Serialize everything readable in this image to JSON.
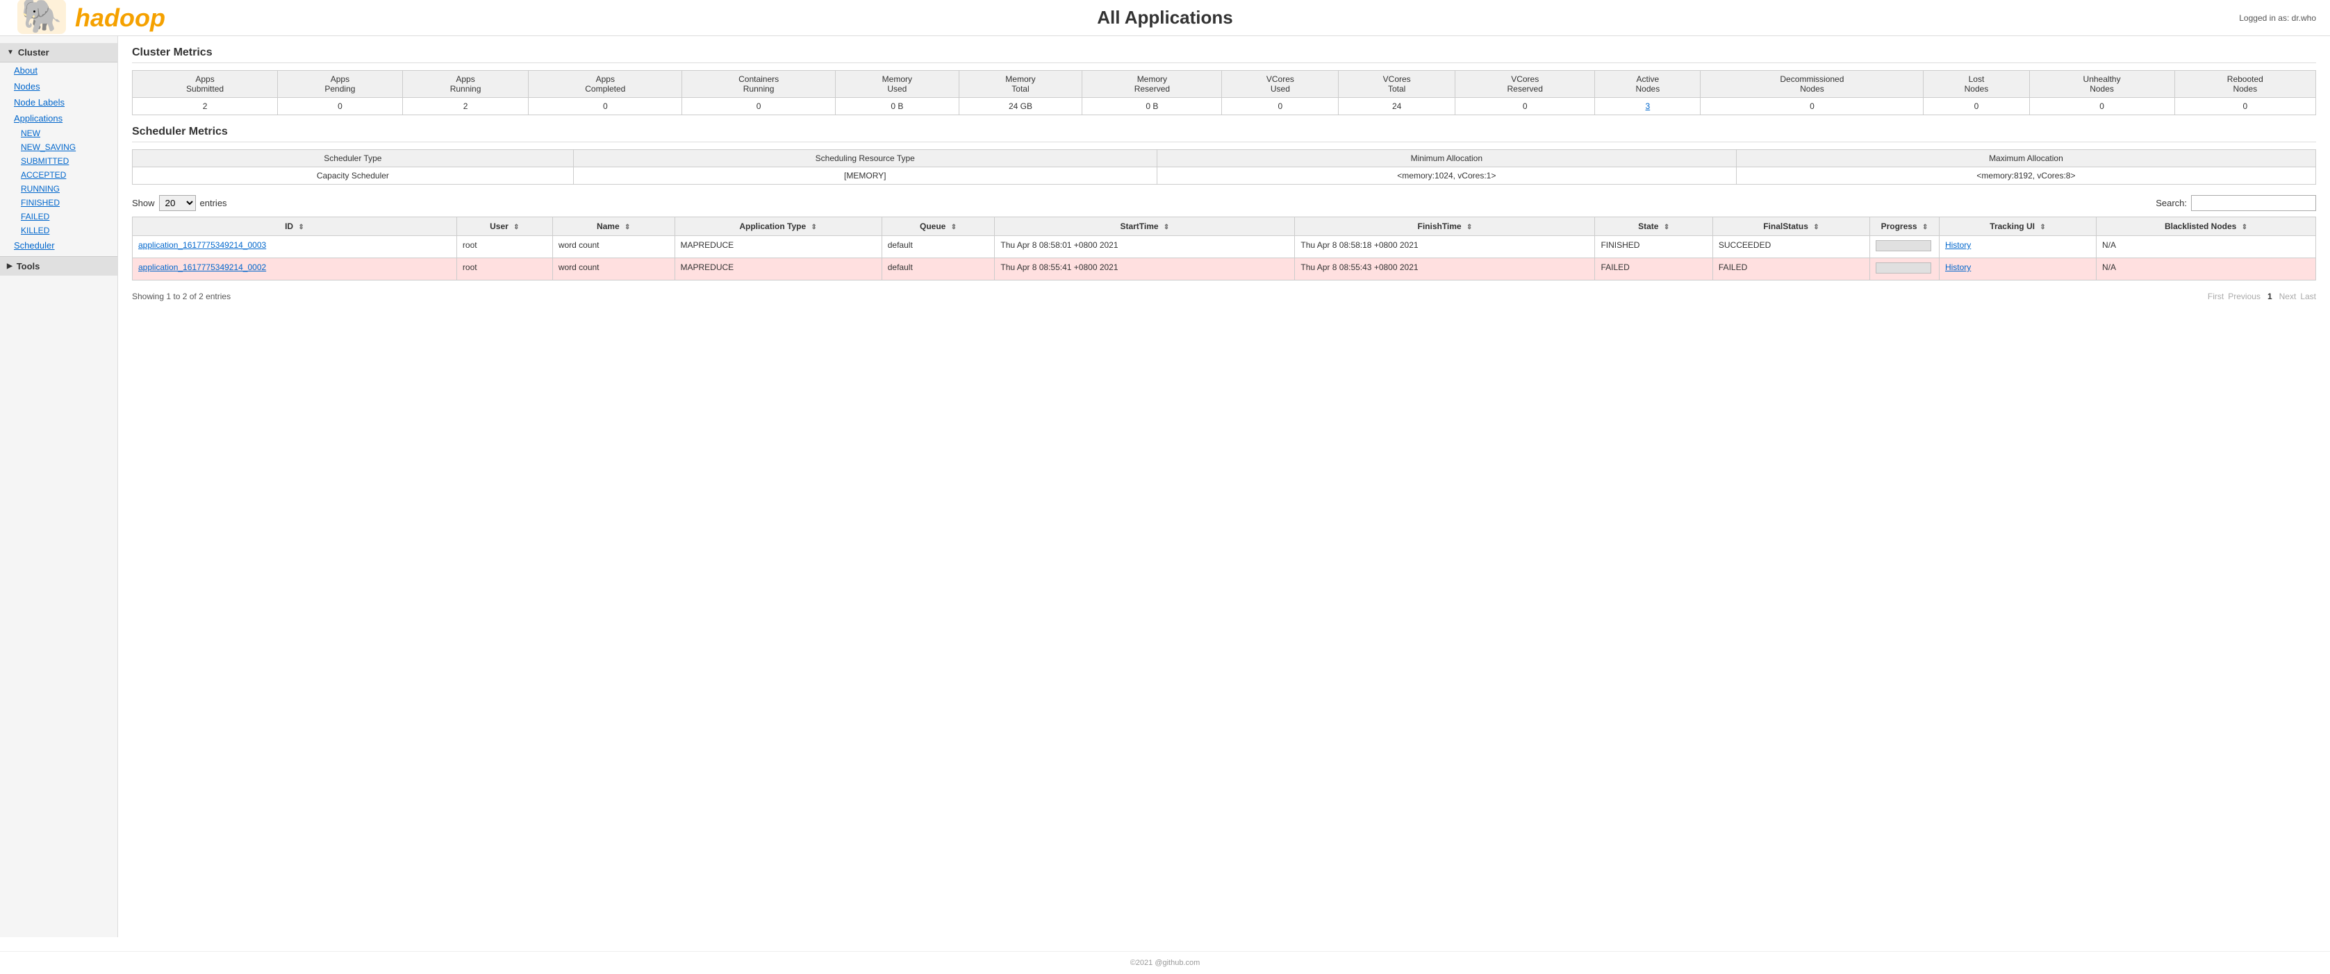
{
  "header": {
    "title": "All Applications",
    "logged_in_text": "Logged in as: dr.who"
  },
  "sidebar": {
    "cluster_label": "Cluster",
    "links": [
      {
        "label": "About",
        "name": "about"
      },
      {
        "label": "Nodes",
        "name": "nodes"
      },
      {
        "label": "Node Labels",
        "name": "node-labels"
      },
      {
        "label": "Applications",
        "name": "applications"
      }
    ],
    "app_sub_links": [
      {
        "label": "NEW",
        "name": "new"
      },
      {
        "label": "NEW_SAVING",
        "name": "new-saving"
      },
      {
        "label": "SUBMITTED",
        "name": "submitted"
      },
      {
        "label": "ACCEPTED",
        "name": "accepted"
      },
      {
        "label": "RUNNING",
        "name": "running"
      },
      {
        "label": "FINISHED",
        "name": "finished"
      },
      {
        "label": "FAILED",
        "name": "failed"
      },
      {
        "label": "KILLED",
        "name": "killed"
      }
    ],
    "scheduler_label": "Scheduler",
    "tools_label": "Tools"
  },
  "cluster_metrics": {
    "title": "Cluster Metrics",
    "columns": [
      "Apps Submitted",
      "Apps Pending",
      "Apps Running",
      "Apps Completed",
      "Containers Running",
      "Memory Used",
      "Memory Total",
      "Memory Reserved",
      "VCores Used",
      "VCores Total",
      "VCores Reserved",
      "Active Nodes",
      "Decommissioned Nodes",
      "Lost Nodes",
      "Unhealthy Nodes",
      "Rebooted Nodes"
    ],
    "values": [
      "2",
      "0",
      "2",
      "0",
      "0",
      "0 B",
      "24 GB",
      "0 B",
      "0",
      "24",
      "0",
      "3",
      "0",
      "0",
      "0",
      "0"
    ]
  },
  "scheduler_metrics": {
    "title": "Scheduler Metrics",
    "columns": [
      "Scheduler Type",
      "Scheduling Resource Type",
      "Minimum Allocation",
      "Maximum Allocation"
    ],
    "values": [
      "Capacity Scheduler",
      "[MEMORY]",
      "<memory:1024, vCores:1>",
      "<memory:8192, vCores:8>"
    ]
  },
  "table_controls": {
    "show_label": "Show",
    "show_value": "20",
    "entries_label": "entries",
    "search_label": "Search:",
    "search_value": ""
  },
  "applications_table": {
    "columns": [
      {
        "label": "ID",
        "name": "id"
      },
      {
        "label": "User",
        "name": "user"
      },
      {
        "label": "Name",
        "name": "name"
      },
      {
        "label": "Application Type",
        "name": "application-type"
      },
      {
        "label": "Queue",
        "name": "queue"
      },
      {
        "label": "StartTime",
        "name": "start-time"
      },
      {
        "label": "FinishTime",
        "name": "finish-time"
      },
      {
        "label": "State",
        "name": "state"
      },
      {
        "label": "FinalStatus",
        "name": "final-status"
      },
      {
        "label": "Progress",
        "name": "progress"
      },
      {
        "label": "Tracking UI",
        "name": "tracking-ui"
      },
      {
        "label": "Blacklisted Nodes",
        "name": "blacklisted-nodes"
      }
    ],
    "rows": [
      {
        "id": "application_1617775349214_0003",
        "user": "root",
        "name": "word count",
        "application_type": "MAPREDUCE",
        "queue": "default",
        "start_time": "Thu Apr 8 08:58:01 +0800 2021",
        "finish_time": "Thu Apr 8 08:58:18 +0800 2021",
        "state": "FINISHED",
        "final_status": "SUCCEEDED",
        "progress": 0,
        "tracking_ui": "History",
        "blacklisted_nodes": "N/A",
        "row_class": "row-succeeded"
      },
      {
        "id": "application_1617775349214_0002",
        "user": "root",
        "name": "word count",
        "application_type": "MAPREDUCE",
        "queue": "default",
        "start_time": "Thu Apr 8 08:55:41 +0800 2021",
        "finish_time": "Thu Apr 8 08:55:43 +0800 2021",
        "state": "FAILED",
        "final_status": "FAILED",
        "progress": 0,
        "tracking_ui": "History",
        "blacklisted_nodes": "N/A",
        "row_class": "row-failed"
      }
    ]
  },
  "pagination": {
    "showing_text": "Showing 1 to 2 of 2 entries",
    "first_label": "First",
    "previous_label": "Previous",
    "current_page": "1",
    "next_label": "Next",
    "last_label": "Last"
  },
  "footer": {
    "text": "©2021 @github.com"
  }
}
